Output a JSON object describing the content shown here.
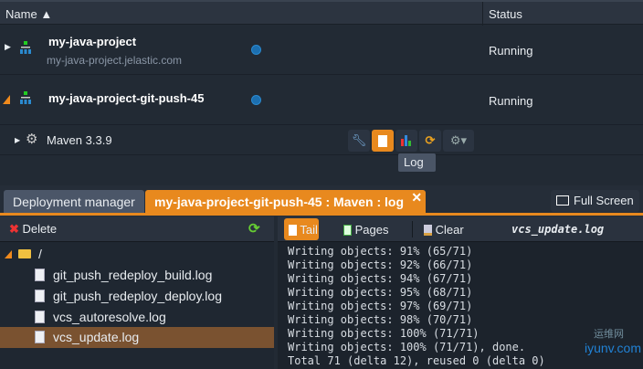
{
  "header": {
    "name": "Name",
    "status": "Status"
  },
  "environments": [
    {
      "name": "my-java-project",
      "domain": "my-java-project.jelastic.com",
      "status": "Running"
    },
    {
      "name": "my-java-project-git-push-45",
      "status": "Running"
    }
  ],
  "node": {
    "name": "Maven 3.3.9",
    "tooltip": "Log"
  },
  "tabs": {
    "deployment": "Deployment manager",
    "active": "my-java-project-git-push-45 : Maven : log",
    "fullscreen": "Full Screen"
  },
  "left": {
    "delete": "Delete",
    "root": "/",
    "files": [
      "git_push_redeploy_build.log",
      "git_push_redeploy_deploy.log",
      "vcs_autoresolve.log",
      "vcs_update.log"
    ]
  },
  "right": {
    "tail": "Tail",
    "pages": "Pages",
    "clear": "Clear",
    "filename": "vcs_update.log",
    "lines": [
      "Writing objects: 91% (65/71)",
      "Writing objects: 92% (66/71)",
      "Writing objects: 94% (67/71)",
      "Writing objects: 95% (68/71)",
      "Writing objects: 97% (69/71)",
      "Writing objects: 98% (70/71)",
      "Writing objects: 100% (71/71)",
      "Writing objects: 100% (71/71), done.",
      "Total 71 (delta 12), reused 0 (delta 0)"
    ]
  },
  "watermark": {
    "cn": "运维网",
    "site": "iyunv.com"
  },
  "colors": {
    "accent": "#e8891e",
    "selected": "#7a5230"
  }
}
